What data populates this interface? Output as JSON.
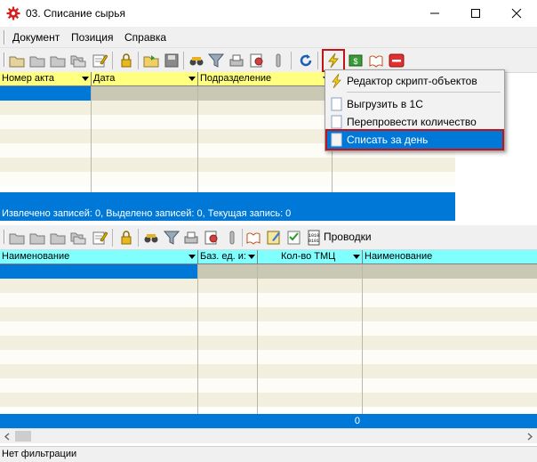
{
  "window": {
    "title": "03. Списание сырья",
    "icon": "gear-red-icon",
    "minimize": "—",
    "maximize": "☐",
    "close": "✕"
  },
  "menu": [
    "Документ",
    "Позиция",
    "Справка"
  ],
  "top_grid": {
    "columns": [
      "Номер акта",
      "Дата",
      "Подразделение",
      ""
    ],
    "status": "Извлечено записей: 0, Выделено записей: 0, Текущая запись: 0"
  },
  "dropdown": {
    "items": [
      {
        "label": "Редактор скрипт-объектов",
        "icon": "lightning-icon"
      },
      {
        "label": "Выгрузить в 1С",
        "icon": "blank-doc-icon"
      },
      {
        "label": "Перепровести количество",
        "icon": "blank-doc-icon"
      },
      {
        "label": "Списать за день",
        "icon": "blank-doc-icon",
        "selected": true
      }
    ]
  },
  "bottom_toolbar": {
    "provodki_label": "Проводки"
  },
  "bottom_grid": {
    "columns": [
      "Наименование",
      "Баз. ед. и:",
      "Кол-во ТМЦ",
      "Наименование"
    ],
    "total": "0"
  },
  "footer": {
    "status": "Нет фильтрации"
  },
  "colors": {
    "top_header": "#ffff80",
    "bottom_header": "#80ffff",
    "row_beige": "#f3efdf",
    "row_white": "#fdfcf6",
    "selection": "#0078d7",
    "highlight_border": "#c4121a"
  }
}
